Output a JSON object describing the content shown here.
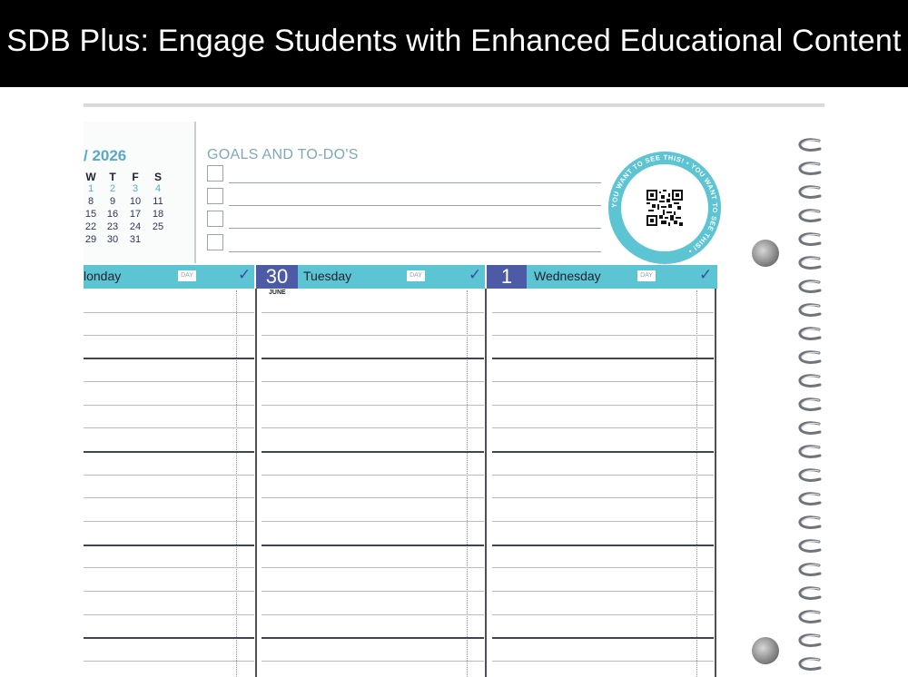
{
  "banner": {
    "title": "SDB Plus: Engage Students with Enhanced Educational Content"
  },
  "mini_calendar": {
    "year_label": "/ 2026",
    "weekdays": [
      "W",
      "T",
      "F",
      "S"
    ],
    "rows": [
      [
        "1",
        "2",
        "3",
        "4"
      ],
      [
        "8",
        "9",
        "10",
        "11"
      ],
      [
        "15",
        "16",
        "17",
        "18"
      ],
      [
        "22",
        "23",
        "24",
        "25"
      ],
      [
        "29",
        "30",
        "31",
        ""
      ]
    ]
  },
  "goals": {
    "title": "GOALS AND TO-DO'S",
    "checkbox_count": 4
  },
  "qr_badge": {
    "ring_text": "YOU WANT TO SEE THIS! • YOU WANT TO SEE THIS! •",
    "color": "#5cc4d3"
  },
  "days": [
    {
      "number": "",
      "name": "londay",
      "tag": "DAY",
      "check": "✓",
      "month": ""
    },
    {
      "number": "30",
      "name": "Tuesday",
      "tag": "DAY",
      "check": "✓",
      "month": "JUNE"
    },
    {
      "number": "1",
      "name": "Wednesday",
      "tag": "DAY",
      "check": "✓",
      "month": ""
    }
  ],
  "colors": {
    "accent_teal": "#5cc4d3",
    "accent_indigo": "#4d5aa6",
    "calendar_year": "#5aa9c7",
    "text_dark": "#1d2230"
  }
}
